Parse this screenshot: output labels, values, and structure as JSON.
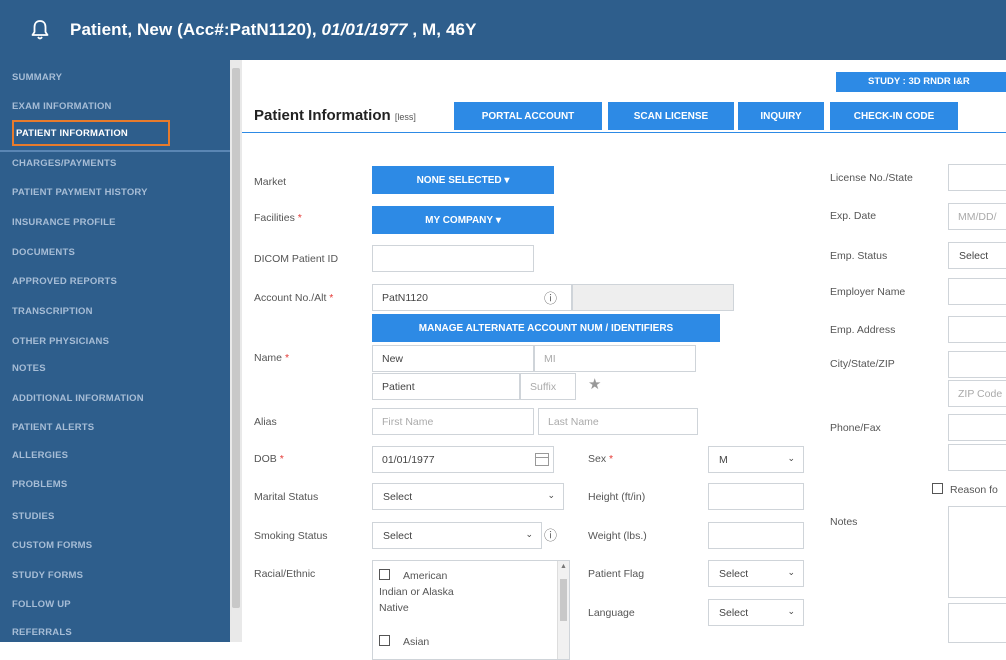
{
  "header": {
    "title_prefix": "Patient, New (Acc#:PatN1120), ",
    "title_dob": "01/01/1977",
    "title_suffix": " , M, 46Y",
    "bell_icon": "bell-icon"
  },
  "sidebar": {
    "items": [
      {
        "label": "SUMMARY"
      },
      {
        "label": "EXAM INFORMATION"
      },
      {
        "label": "PATIENT INFORMATION",
        "active": true
      },
      {
        "label": "CHARGES/PAYMENTS"
      },
      {
        "label": "PATIENT PAYMENT HISTORY"
      },
      {
        "label": "INSURANCE PROFILE"
      },
      {
        "label": "DOCUMENTS"
      },
      {
        "label": "APPROVED REPORTS"
      },
      {
        "label": "TRANSCRIPTION"
      },
      {
        "label": "OTHER PHYSICIANS"
      },
      {
        "label": "NOTES"
      },
      {
        "label": "ADDITIONAL INFORMATION"
      },
      {
        "label": "PATIENT ALERTS"
      },
      {
        "label": "ALLERGIES"
      },
      {
        "label": "PROBLEMS"
      },
      {
        "label": "STUDIES"
      },
      {
        "label": "CUSTOM FORMS"
      },
      {
        "label": "STUDY FORMS"
      },
      {
        "label": "FOLLOW UP"
      },
      {
        "label": "REFERRALS"
      }
    ]
  },
  "main": {
    "study_button": "STUDY : 3D RNDR I&R",
    "title": "Patient Information",
    "less_link": "[less]",
    "buttons": {
      "portal": "PORTAL ACCOUNT",
      "scan": "SCAN LICENSE",
      "inquiry": "INQUIRY",
      "checkin": "CHECK-IN CODE"
    }
  },
  "form": {
    "market_label": "Market",
    "market_value": "NONE SELECTED",
    "facilities_label": "Facilities",
    "facilities_value": "MY COMPANY",
    "dicom_label": "DICOM Patient ID",
    "account_label": "Account No./Alt",
    "account_value": "PatN1120",
    "manage_alt": "MANAGE ALTERNATE ACCOUNT NUM / IDENTIFIERS",
    "name_label": "Name",
    "first_name": "New",
    "middle_ph": "MI",
    "last_name": "Patient",
    "suffix_ph": "Suffix",
    "alias_label": "Alias",
    "alias_first_ph": "First Name",
    "alias_last_ph": "Last Name",
    "dob_label": "DOB",
    "dob_value": "01/01/1977",
    "sex_label": "Sex",
    "sex_value": "M",
    "marital_label": "Marital Status",
    "marital_value": "Select",
    "height_label": "Height (ft/in)",
    "smoking_label": "Smoking Status",
    "smoking_value": "Select",
    "weight_label": "Weight (lbs.)",
    "racial_label": "Racial/Ethnic",
    "racial_opt1_line1": "American",
    "racial_opt1_line2": "Indian or Alaska",
    "racial_opt1_line3": "Native",
    "racial_opt2": "Asian",
    "flag_label": "Patient Flag",
    "flag_value": "Select",
    "language_label": "Language",
    "language_value": "Select",
    "required_mark": "*"
  },
  "right": {
    "license_label": "License No./State",
    "exp_label": "Exp. Date",
    "exp_ph": "MM/DD/",
    "empstatus_label": "Emp. Status",
    "empstatus_value": "Select",
    "employer_label": "Employer Name",
    "empaddr_label": "Emp. Address",
    "city_label": "City/State/ZIP",
    "zip_ph": "ZIP Code",
    "phone_label": "Phone/Fax",
    "reason_label": "Reason fo",
    "notes_label": "Notes"
  },
  "colors": {
    "header_bg": "#2e5e8c",
    "accent": "#2d8ae5",
    "active_border": "#e87b2c",
    "required": "#e53935"
  }
}
